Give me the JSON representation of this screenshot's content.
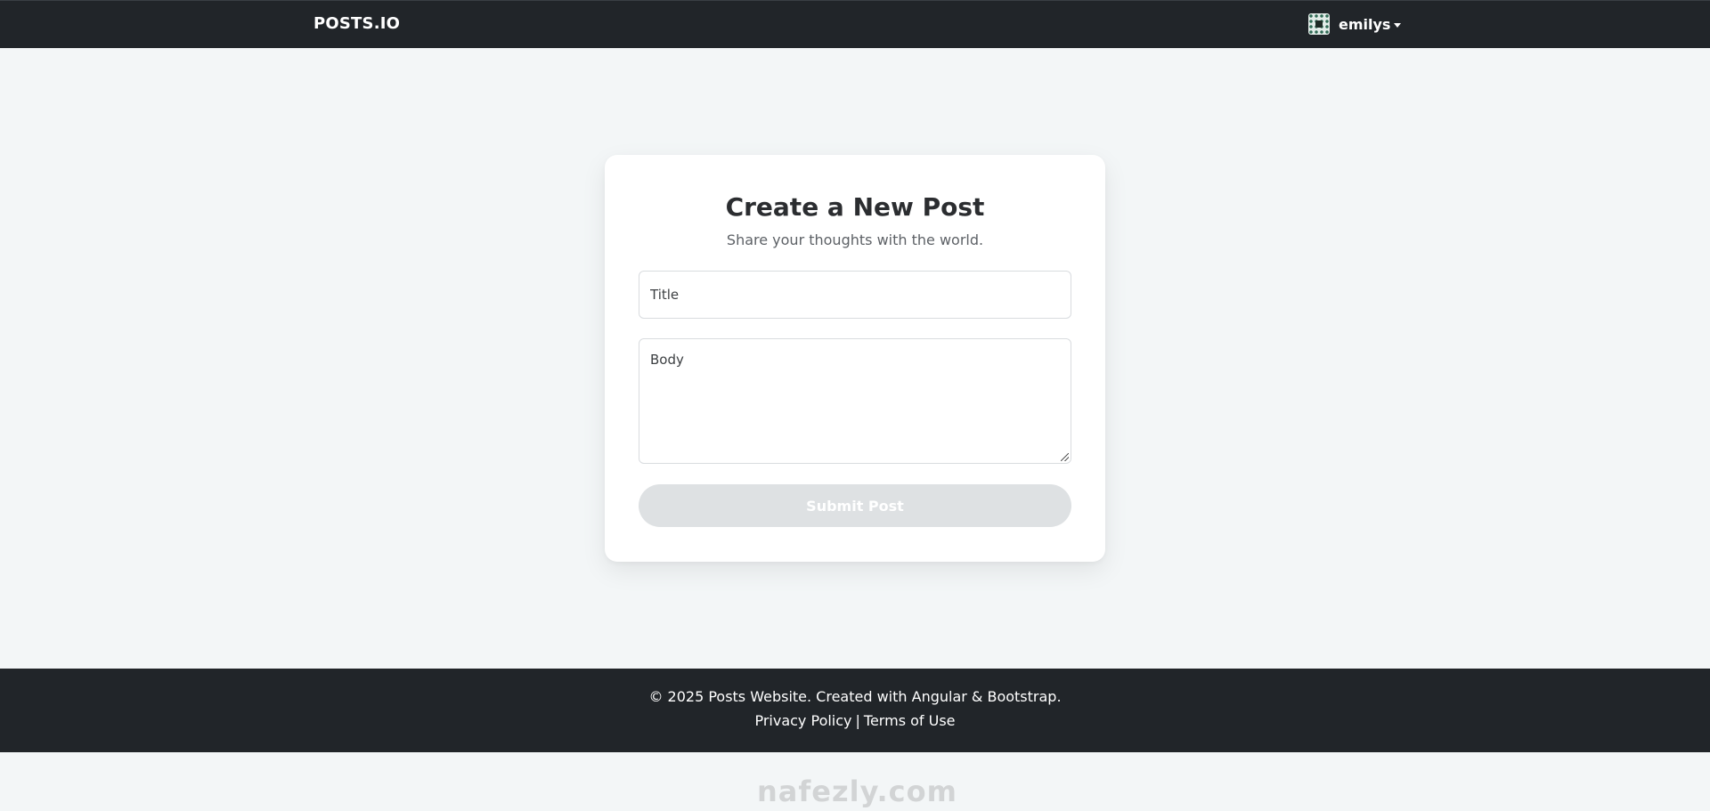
{
  "header": {
    "brand": "POSTS.IO",
    "user": {
      "avatar_icon": "avatar-icon",
      "username": "emilys",
      "menu_icon": "caret-down-icon"
    }
  },
  "form": {
    "title": "Create a New Post",
    "subtitle": "Share your thoughts with the world.",
    "title_placeholder": "Title",
    "body_placeholder": "Body",
    "submit_label": "Submit Post"
  },
  "footer": {
    "copyright": "© 2025 Posts Website. Created with Angular & Bootstrap.",
    "privacy_label": "Privacy Policy",
    "separator": "|",
    "terms_label": "Terms of Use"
  },
  "watermark": {
    "domain": "nafezly.com"
  },
  "colors": {
    "navbar": "#212529",
    "page_background": "#f3f6f7",
    "button_disabled": "#dee1e3"
  }
}
